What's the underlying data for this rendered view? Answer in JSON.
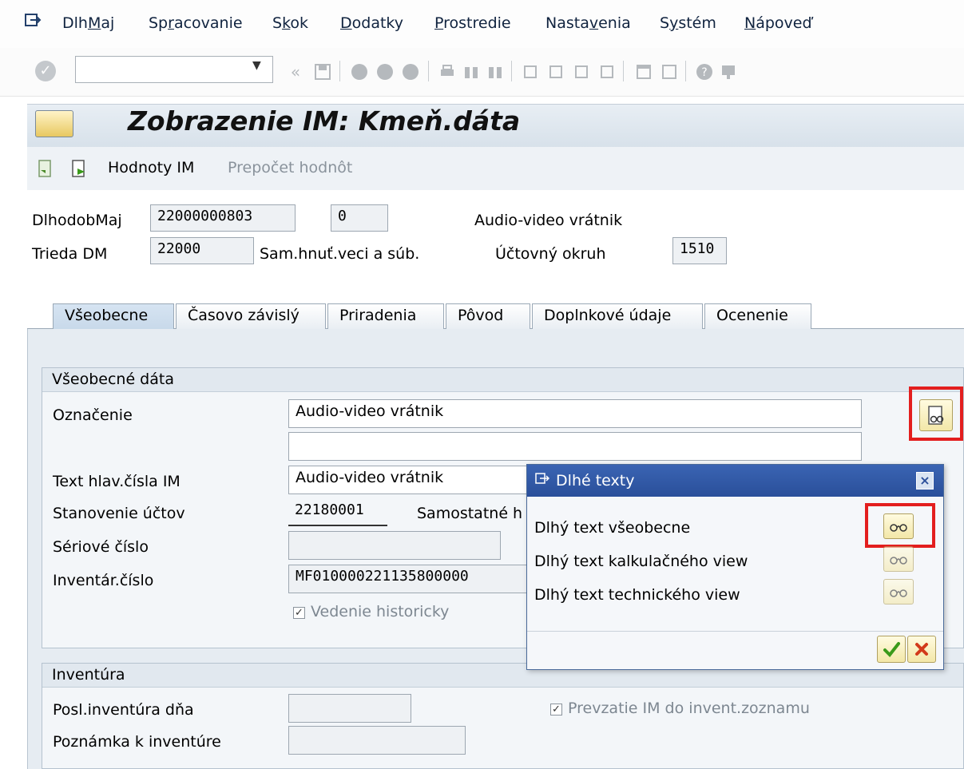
{
  "menu": {
    "items": [
      {
        "pre": "Dlh",
        "u": "M",
        "post": "aj"
      },
      {
        "pre": "Sp",
        "u": "r",
        "post": "acovanie"
      },
      {
        "pre": "S",
        "u": "k",
        "post": "ok"
      },
      {
        "pre": "",
        "u": "D",
        "post": "odatky"
      },
      {
        "pre": "",
        "u": "P",
        "post": "rostredie"
      },
      {
        "pre": "Nasta",
        "u": "v",
        "post": "enia"
      },
      {
        "pre": "S",
        "u": "y",
        "post": "stém"
      },
      {
        "pre": "",
        "u": "N",
        "post": "ápoveď"
      }
    ]
  },
  "toolbar": {
    "command_field_value": ""
  },
  "title": {
    "text": "Zobrazenie IM:  Kmeň.dáta"
  },
  "app_toolbar": {
    "values_label": "Hodnoty IM",
    "recalc_label": "Prepočet hodnôt"
  },
  "header": {
    "asset_label": "DlhodobMaj",
    "asset_number": "22000000803",
    "asset_sub": "0",
    "asset_description": "Audio-video vrátnik",
    "class_label": "Trieda DM",
    "class_value": "22000",
    "class_text": "Sam.hnuť.veci a súb.",
    "company_label": "Účtovný okruh",
    "company_value": "1510"
  },
  "tabs": [
    {
      "label": "Všeobecne"
    },
    {
      "label": "Časovo závislý"
    },
    {
      "label": "Priradenia"
    },
    {
      "label": "Pôvod"
    },
    {
      "label": "Doplnkové údaje"
    },
    {
      "label": "Ocenenie"
    }
  ],
  "general": {
    "group_title": "Všeobecné dáta",
    "designation_label": "Označenie",
    "designation_value": "Audio-video vrátnik",
    "designation_value2": "",
    "main_text_label": "Text hlav.čísla IM",
    "main_text_value": "Audio-video vrátnik",
    "account_det_label": "Stanovenie účtov",
    "account_det_value": "22180001",
    "account_det_text": "Samostatné h",
    "serial_label": "Sériové číslo",
    "serial_value": "",
    "inventory_label": "Inventár.číslo",
    "inventory_value": "MF010000221135800000",
    "history_label": "Vedenie historicky"
  },
  "inventory": {
    "group_title": "Inventúra",
    "last_label": "Posl.inventúra dňa",
    "last_value": "",
    "note_label": "Poznámka k inventúre",
    "note_value": "",
    "include_label": "Prevzatie IM do invent.zoznamu"
  },
  "dialog": {
    "title": "Dlhé texty",
    "items": [
      {
        "label": "Dlhý text všeobecne"
      },
      {
        "label": "Dlhý text kalkulačného view"
      },
      {
        "label": "Dlhý text technického view"
      }
    ]
  },
  "colors": {
    "highlight": "#e31e1e",
    "dialog_title": "#2f57a6",
    "confirm": "#3a9a1a",
    "cancel": "#d23a1a"
  }
}
